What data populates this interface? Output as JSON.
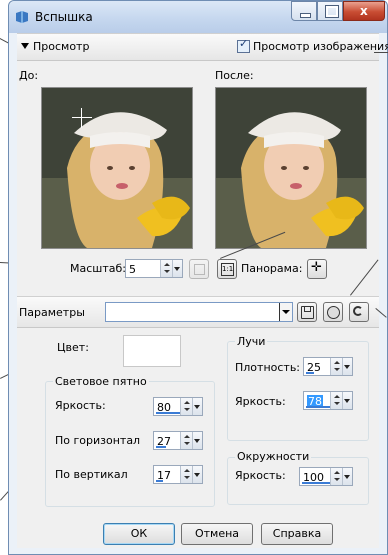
{
  "window": {
    "title": "Вспышка",
    "close_symbol": "x"
  },
  "preview": {
    "section_label": "Просмотр",
    "preview_checkbox_label": "Просмотр изображения",
    "preview_checked": true,
    "before_label": "До:",
    "after_label": "После:",
    "zoom_label": "Масштаб:",
    "zoom_value": "5",
    "pan_label": "Панорама:"
  },
  "params": {
    "label": "Параметры",
    "preset_value": ""
  },
  "color_label": "Цвет:",
  "light_spot": {
    "group_label": "Световое пятно",
    "brightness_label": "Яркость:",
    "brightness_value": "80",
    "horizontal_label": "По горизонтал",
    "horizontal_value": "27",
    "vertical_label": "По вертикал",
    "vertical_value": "17"
  },
  "rays": {
    "group_label": "Лучи",
    "density_label": "Плотность:",
    "density_value": "25",
    "brightness_label": "Яркость:",
    "brightness_value": "78"
  },
  "circles": {
    "group_label": "Окружности",
    "brightness_label": "Яркость:",
    "brightness_value": "100"
  },
  "buttons": {
    "ok": "ОК",
    "cancel": "Отмена",
    "help": "Справка"
  },
  "colors": {
    "accent": "#3399ff",
    "title_bar": "#c4d6ee",
    "close_button": "#c94d33"
  }
}
